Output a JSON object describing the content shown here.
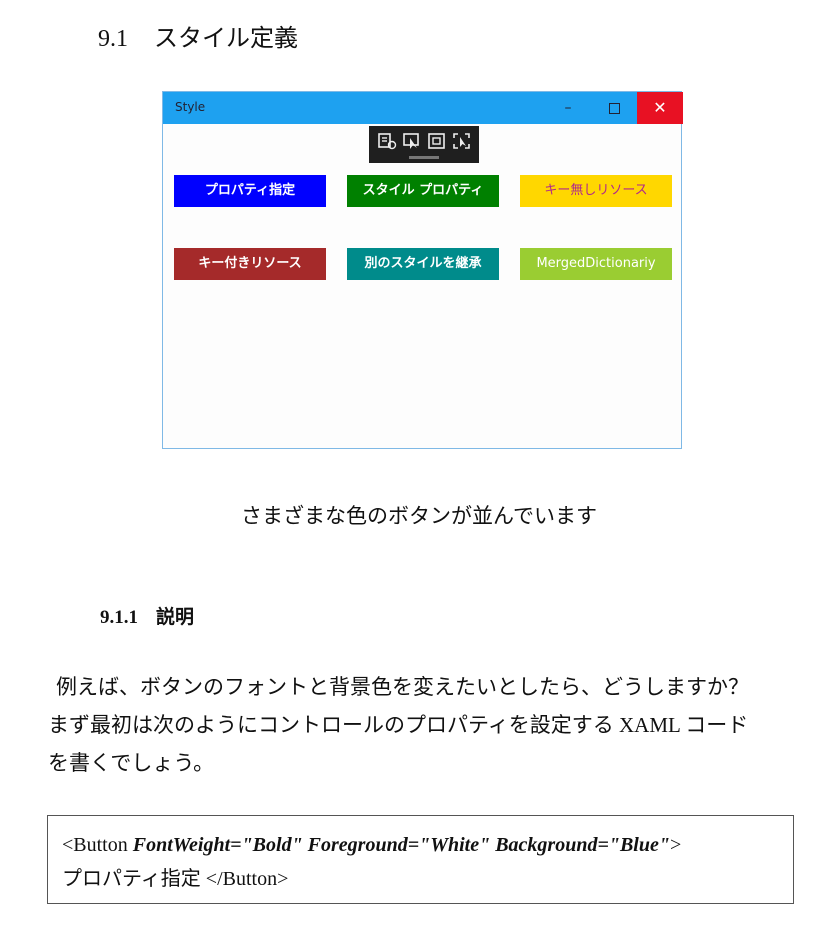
{
  "section": {
    "number": "9.1",
    "title": "スタイル定義"
  },
  "screenshot": {
    "window_title": "Style",
    "window_controls": {
      "minimize": "–",
      "close": "✕"
    },
    "buttons": [
      {
        "label": "プロパティ指定",
        "bg": "#0000ff",
        "fg": "#ffffff"
      },
      {
        "label": "スタイル プロパティ",
        "bg": "#008000",
        "fg": "#ffffff"
      },
      {
        "label": "キー無しリソース",
        "bg": "#ffd700",
        "fg": "#b0288c"
      },
      {
        "label": "キー付きリソース",
        "bg": "#a52a2a",
        "fg": "#ffffff"
      },
      {
        "label": "別のスタイルを継承",
        "bg": "#008b8b",
        "fg": "#ffffff"
      },
      {
        "label": "MergedDictionariy",
        "bg": "#9acd32",
        "fg": "#ffffff"
      }
    ]
  },
  "caption": "さまざまな色のボタンが並んでいます",
  "subsection": {
    "number": "9.1.1",
    "title": "説明"
  },
  "paragraph": [
    "例えば、ボタンのフォントと背景色を変えたいとしたら、どうしますか？",
    "まず最初は次のようにコントロールのプロパティを設定する XAML コード",
    "を書くでしょう。"
  ],
  "code": {
    "open": "<Button ",
    "attrs": "FontWeight=\"Bold\" Foreground=\"White\" Background=\"Blue\"",
    "close_bracket": ">",
    "line2": "プロパティ指定 </Button>"
  }
}
